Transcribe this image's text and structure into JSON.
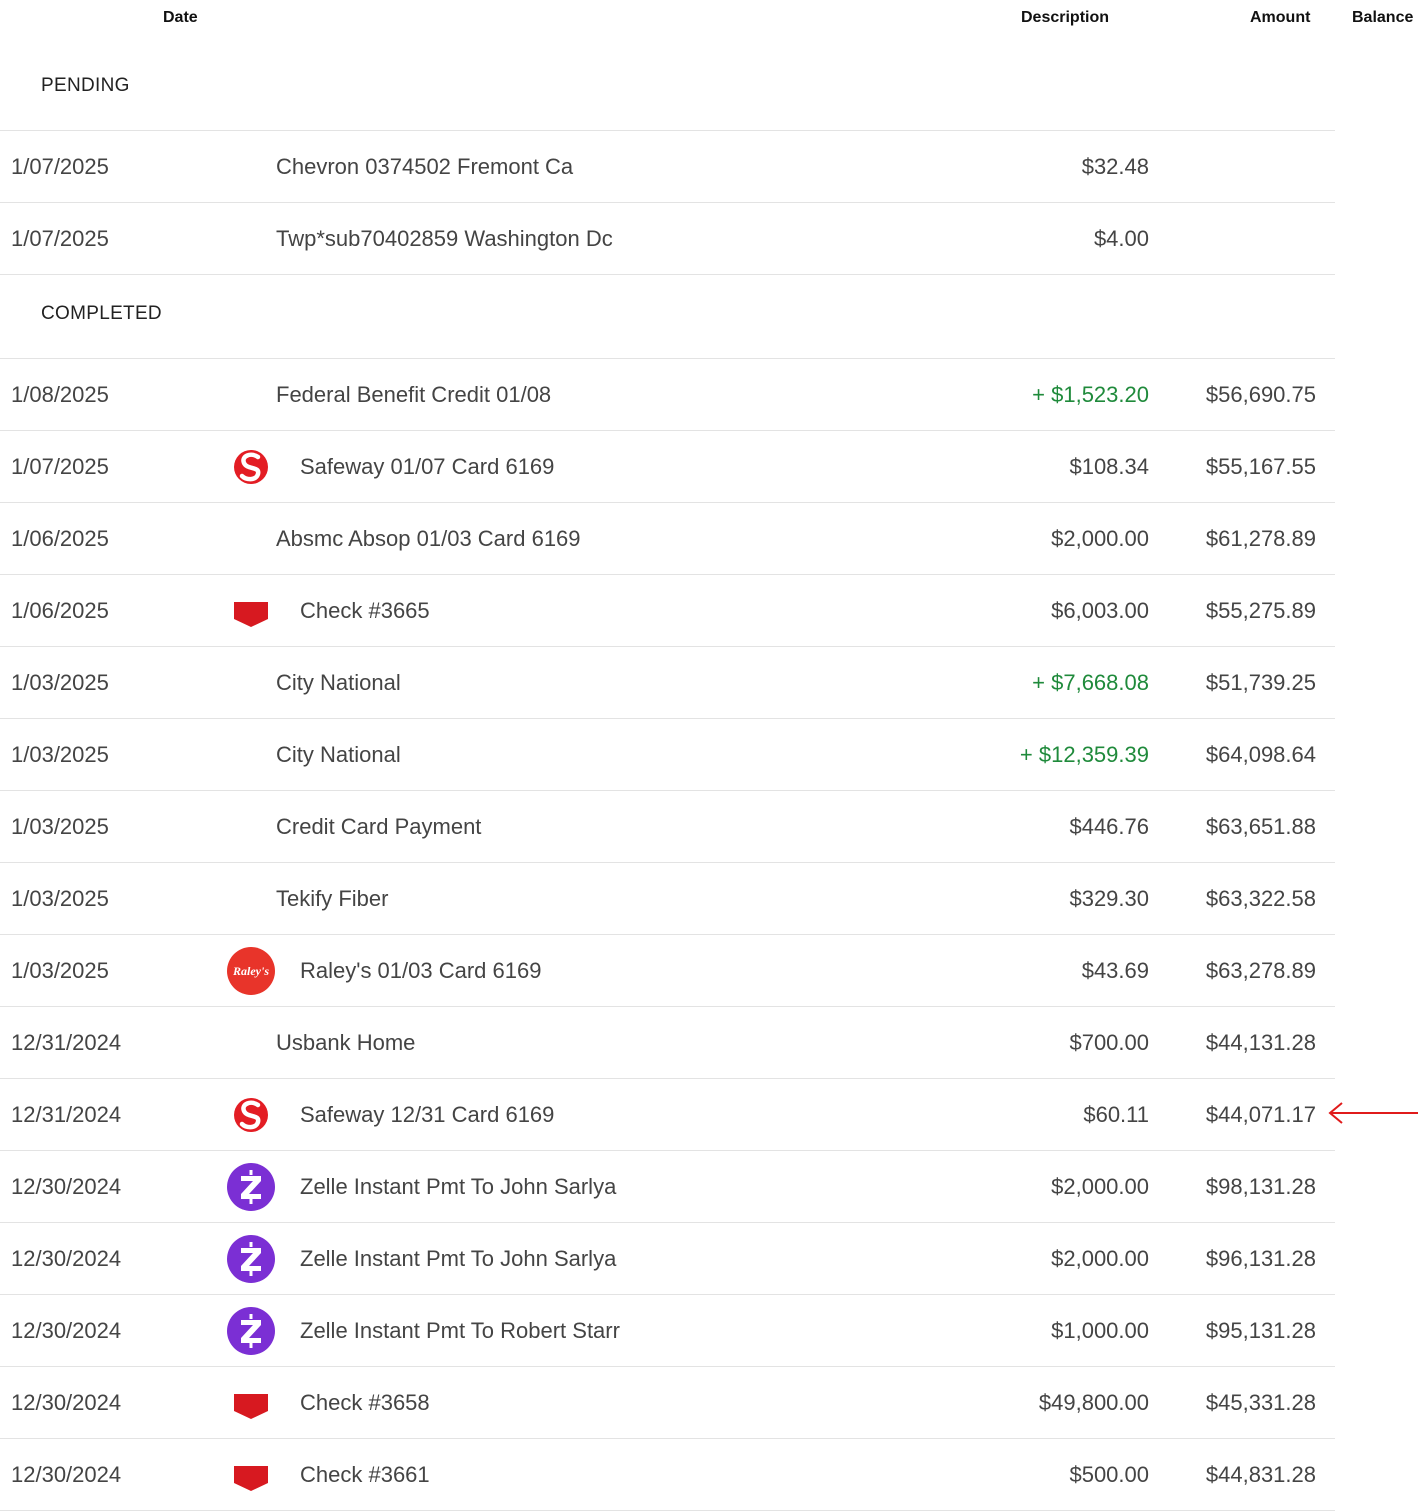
{
  "headers": {
    "date": "Date",
    "description": "Description",
    "amount": "Amount",
    "balance": "Balance"
  },
  "sections": {
    "pending": "PENDING",
    "completed": "COMPLETED"
  },
  "pending": [
    {
      "date": "1/07/2025",
      "description": "Chevron 0374502 Fremont Ca",
      "amount": "$32.48",
      "balance": "",
      "credit": false,
      "icon": ""
    },
    {
      "date": "1/07/2025",
      "description": "Twp*sub70402859 Washington Dc",
      "amount": "$4.00",
      "balance": "",
      "credit": false,
      "icon": ""
    }
  ],
  "completed": [
    {
      "date": "1/08/2025",
      "description": "Federal Benefit Credit 01/08",
      "amount": "+ $1,523.20",
      "balance": "$56,690.75",
      "credit": true,
      "icon": ""
    },
    {
      "date": "1/07/2025",
      "description": "Safeway 01/07 Card 6169",
      "amount": "$108.34",
      "balance": "$55,167.55",
      "credit": false,
      "icon": "safeway-logo-icon"
    },
    {
      "date": "1/06/2025",
      "description": "Absmc Absop 01/03 Card 6169",
      "amount": "$2,000.00",
      "balance": "$61,278.89",
      "credit": false,
      "icon": ""
    },
    {
      "date": "1/06/2025",
      "description": "Check #3665",
      "amount": "$6,003.00",
      "balance": "$55,275.89",
      "credit": false,
      "icon": "check-icon"
    },
    {
      "date": "1/03/2025",
      "description": "City National",
      "amount": "+ $7,668.08",
      "balance": "$51,739.25",
      "credit": true,
      "icon": ""
    },
    {
      "date": "1/03/2025",
      "description": "City National",
      "amount": "+ $12,359.39",
      "balance": "$64,098.64",
      "credit": true,
      "icon": ""
    },
    {
      "date": "1/03/2025",
      "description": "Credit Card Payment",
      "amount": "$446.76",
      "balance": "$63,651.88",
      "credit": false,
      "icon": ""
    },
    {
      "date": "1/03/2025",
      "description": "Tekify Fiber",
      "amount": "$329.30",
      "balance": "$63,322.58",
      "credit": false,
      "icon": ""
    },
    {
      "date": "1/03/2025",
      "description": "Raley's 01/03 Card 6169",
      "amount": "$43.69",
      "balance": "$63,278.89",
      "credit": false,
      "icon": "raleys-logo-icon"
    },
    {
      "date": "12/31/2024",
      "description": "Usbank Home",
      "amount": "$700.00",
      "balance": "$44,131.28",
      "credit": false,
      "icon": ""
    },
    {
      "date": "12/31/2024",
      "description": "Safeway 12/31 Card 6169",
      "amount": "$60.11",
      "balance": "$44,071.17",
      "credit": false,
      "icon": "safeway-logo-icon"
    },
    {
      "date": "12/30/2024",
      "description": "Zelle Instant Pmt To John Sarlya",
      "amount": "$2,000.00",
      "balance": "$98,131.28",
      "credit": false,
      "icon": "zelle-logo-icon"
    },
    {
      "date": "12/30/2024",
      "description": "Zelle Instant Pmt To John Sarlya",
      "amount": "$2,000.00",
      "balance": "$96,131.28",
      "credit": false,
      "icon": "zelle-logo-icon"
    },
    {
      "date": "12/30/2024",
      "description": "Zelle Instant Pmt To Robert Starr",
      "amount": "$1,000.00",
      "balance": "$95,131.28",
      "credit": false,
      "icon": "zelle-logo-icon"
    },
    {
      "date": "12/30/2024",
      "description": "Check #3658",
      "amount": "$49,800.00",
      "balance": "$45,331.28",
      "credit": false,
      "icon": "check-icon"
    },
    {
      "date": "12/30/2024",
      "description": "Check #3661",
      "amount": "$500.00",
      "balance": "$44,831.28",
      "credit": false,
      "icon": "check-icon"
    }
  ],
  "logo_text": {
    "raleys": "Raley's"
  },
  "colors": {
    "credit": "#1f8a3b",
    "safeway": "#e31d24",
    "check": "#d71920",
    "raleys": "#e8342a",
    "zelle": "#7b2fd4",
    "arrow": "#e01b1b"
  }
}
